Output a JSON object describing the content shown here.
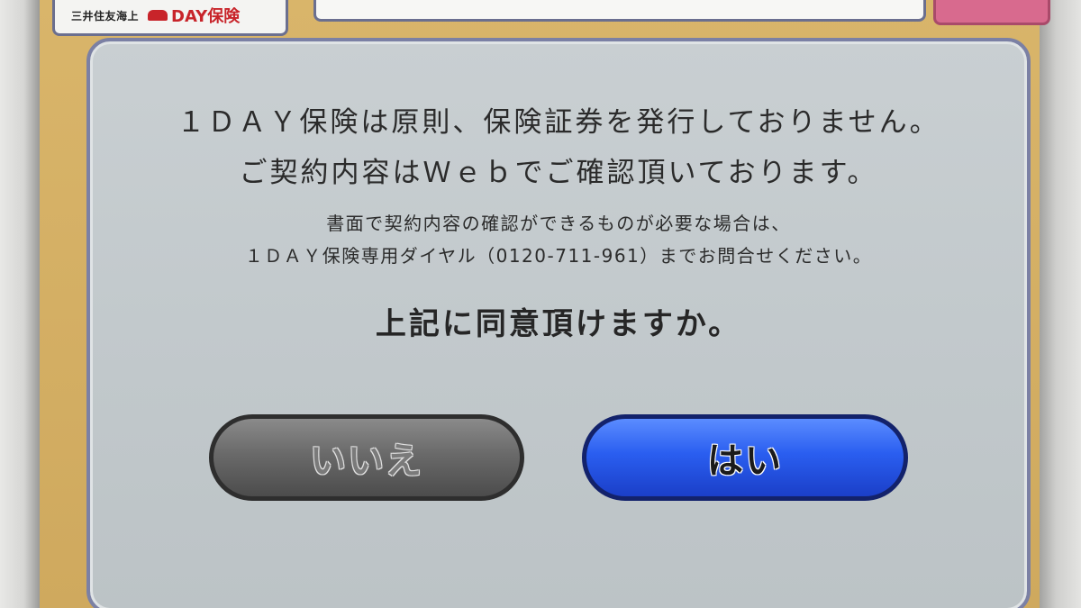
{
  "header": {
    "company": "三井住友海上",
    "brand": "DAY保険"
  },
  "dialog": {
    "main_line1": "１ＤＡＹ保険は原則、保険証券を発行しておりません。",
    "main_line2": "ご契約内容はＷｅｂでご確認頂いております。",
    "sub_line1": "書面で契約内容の確認ができるものが必要な場合は、",
    "sub_line2": "１ＤＡＹ保険専用ダイヤル（0120-711-961）までお問合せください。",
    "question": "上記に同意頂けますか。",
    "no_label": "いいえ",
    "yes_label": "はい"
  },
  "colors": {
    "background": "#cfa95e",
    "dialog_border": "#7b80a4",
    "dialog_fill": "#c4cacd",
    "no_button": "#5a5a5a",
    "yes_button": "#2a5ef0",
    "brand_red": "#c8242a"
  },
  "icons": {
    "brand_logo": "car-icon"
  }
}
